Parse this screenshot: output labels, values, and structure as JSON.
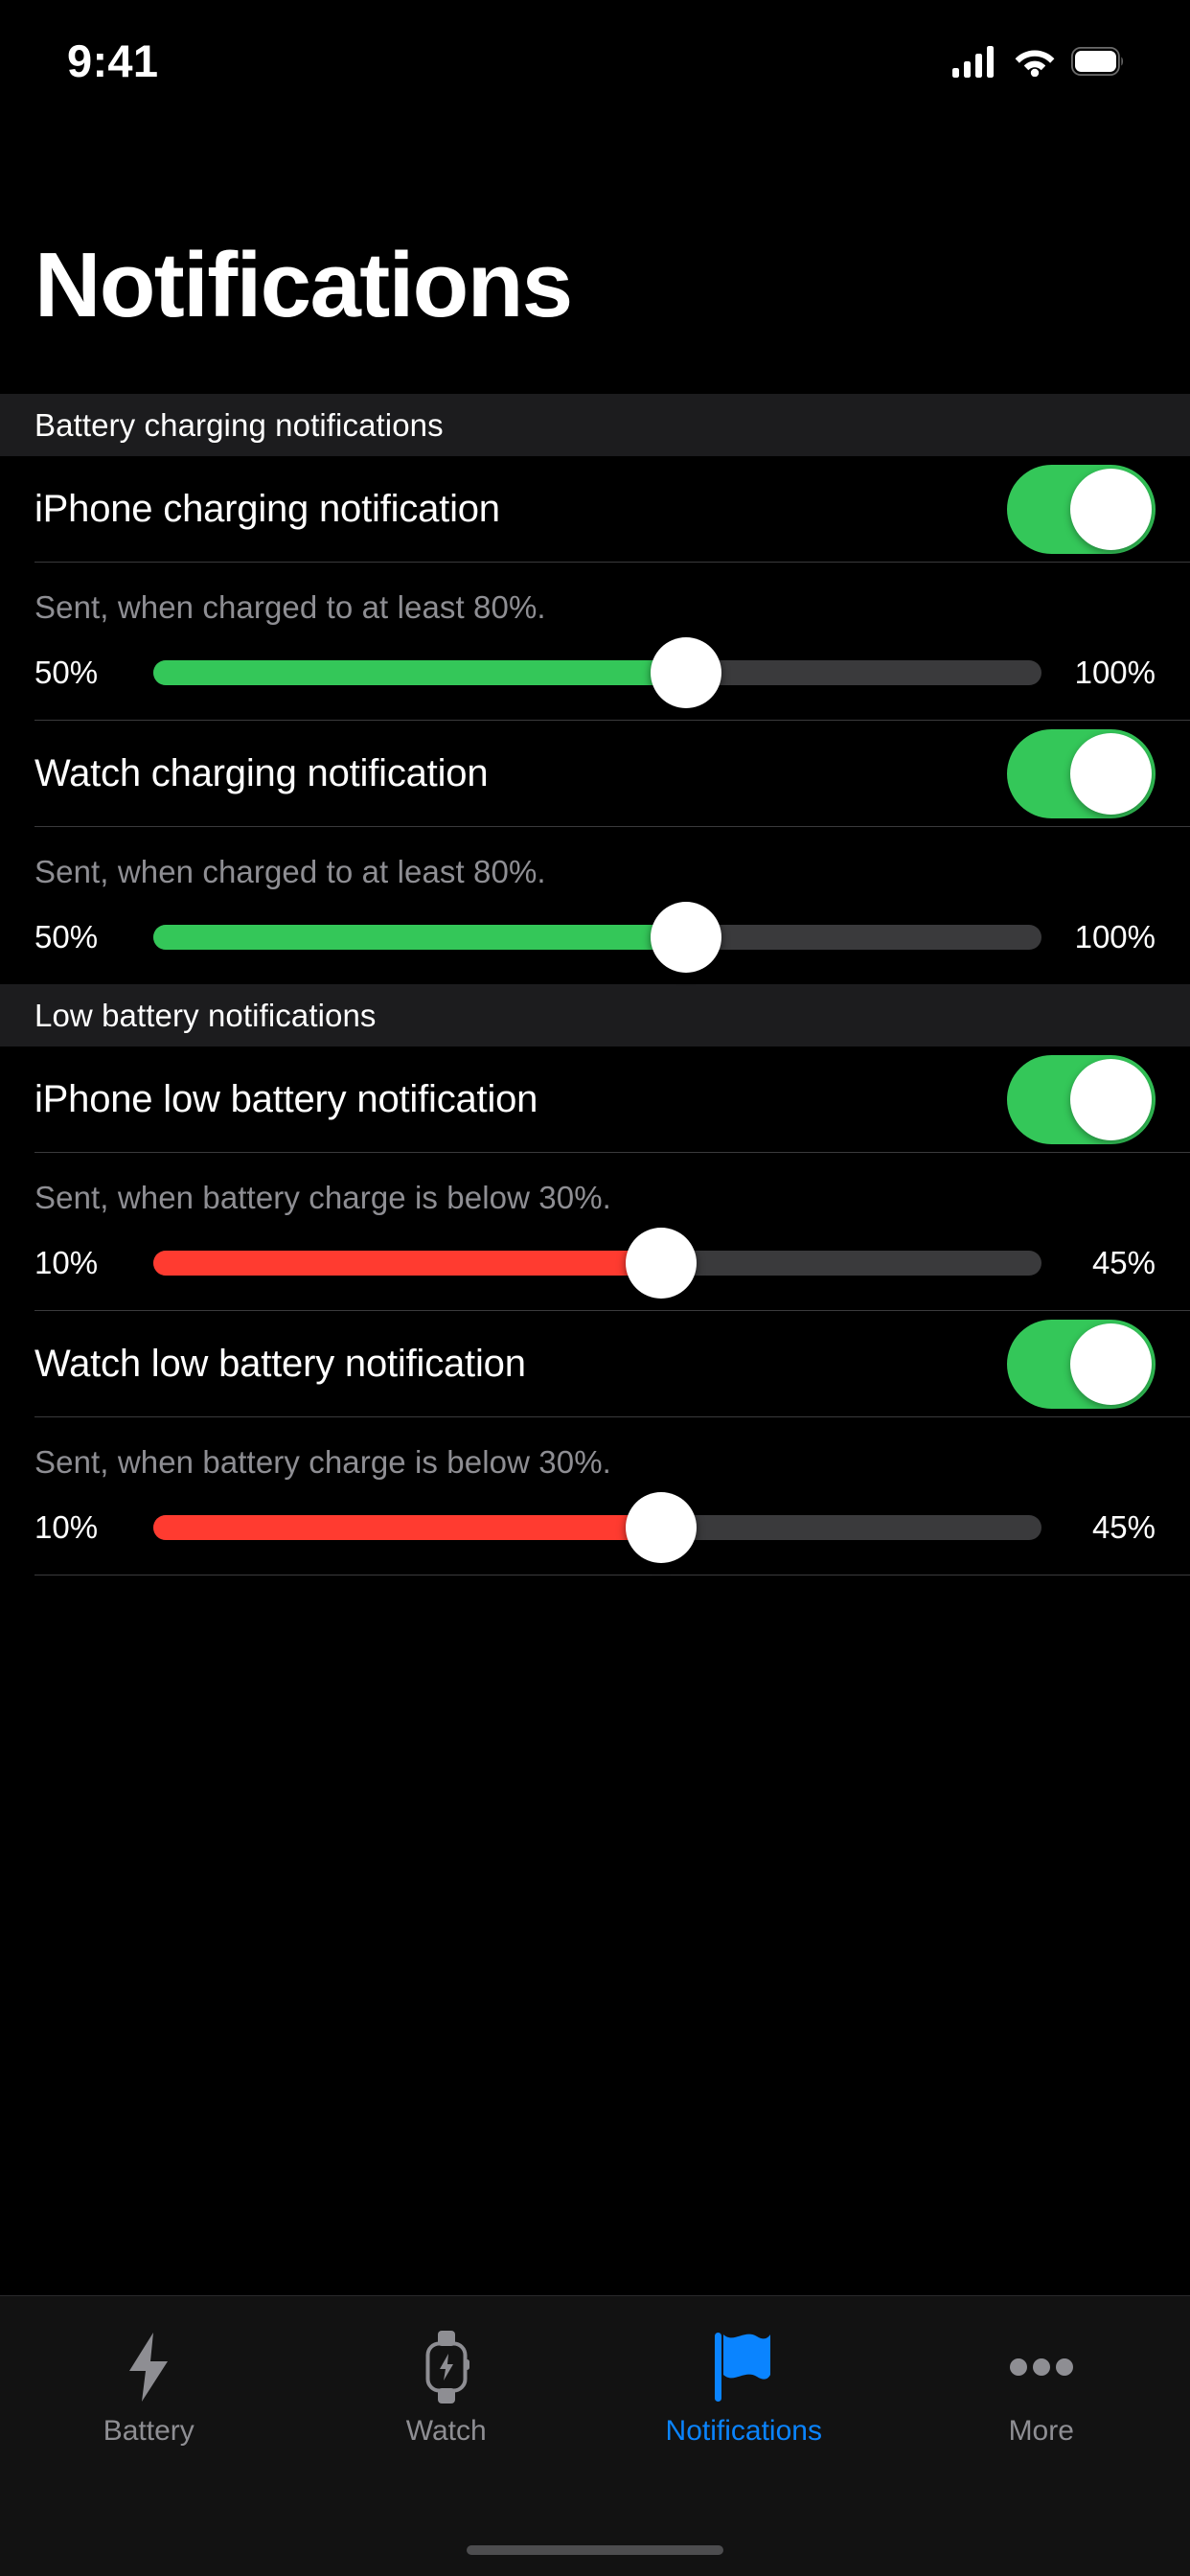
{
  "status_bar": {
    "time": "9:41",
    "cellular_icon": "cellular-signal-icon",
    "wifi_icon": "wifi-icon",
    "battery_icon": "battery-icon"
  },
  "header": {
    "title": "Notifications"
  },
  "sections": [
    {
      "header": "Battery charging notifications",
      "rows": [
        {
          "label": "iPhone charging notification",
          "toggle_on": true,
          "caption": "Sent, when charged to at least 80%.",
          "slider": {
            "min_label": "50%",
            "max_label": "100%",
            "min": 50,
            "max": 100,
            "value": 80,
            "fill_color": "#34c759"
          }
        },
        {
          "label": "Watch charging notification",
          "toggle_on": true,
          "caption": "Sent, when charged to at least 80%.",
          "slider": {
            "min_label": "50%",
            "max_label": "100%",
            "min": 50,
            "max": 100,
            "value": 80,
            "fill_color": "#34c759"
          }
        }
      ]
    },
    {
      "header": "Low battery notifications",
      "rows": [
        {
          "label": "iPhone low battery notification",
          "toggle_on": true,
          "caption": "Sent, when battery charge is below 30%.",
          "slider": {
            "min_label": "10%",
            "max_label": "45%",
            "min": 10,
            "max": 45,
            "value": 30,
            "fill_color": "#ff3b30"
          }
        },
        {
          "label": "Watch low battery notification",
          "toggle_on": true,
          "caption": "Sent, when battery charge is below 30%.",
          "slider": {
            "min_label": "10%",
            "max_label": "45%",
            "min": 10,
            "max": 45,
            "value": 30,
            "fill_color": "#ff3b30"
          }
        }
      ]
    }
  ],
  "tab_bar": {
    "active_color": "#0a84ff",
    "inactive_color": "#8e8e93",
    "tabs": [
      {
        "label": "Battery",
        "icon": "bolt-icon",
        "active": false
      },
      {
        "label": "Watch",
        "icon": "watch-icon",
        "active": false
      },
      {
        "label": "Notifications",
        "icon": "flag-icon",
        "active": true
      },
      {
        "label": "More",
        "icon": "ellipsis-icon",
        "active": false
      }
    ]
  },
  "colors": {
    "background": "#000000",
    "section_header_bg": "#1c1c1e",
    "separator": "#3a3a3c",
    "track": "#3a3a3c",
    "green": "#34c759",
    "red": "#ff3b30",
    "accent": "#0a84ff",
    "secondary_text": "#8e8e93"
  }
}
